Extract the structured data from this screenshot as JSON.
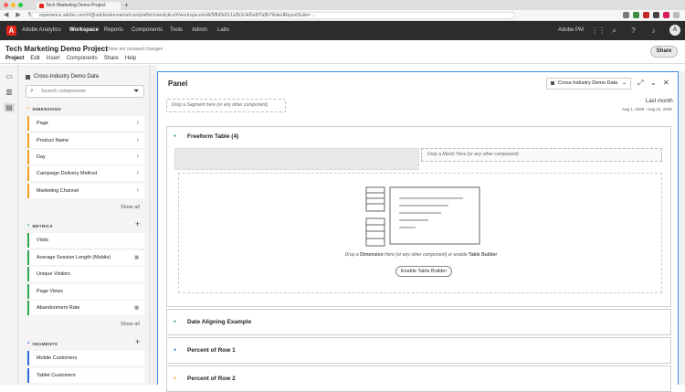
{
  "browser": {
    "tab_title": "Tech Marketing Demo Project",
    "new_tab": "+",
    "nav": "◀ ▶ ↻",
    "url": "experience.adobe.com/#/@adobedemoamericas/platform/analytics/#/workspace/edit/5f8d9e0c1a2b3c4d5e6f7a8b?linkedReportSuite=..."
  },
  "appbar": {
    "logo_letter": "A",
    "app_name": "Adobe Analytics",
    "nav": [
      "Workspace",
      "Reports",
      "Components",
      "Tools",
      "Admin",
      "Labs"
    ],
    "org": "Adobe PM",
    "avatar_letter": "A"
  },
  "project": {
    "title": "Tech Marketing Demo Project",
    "unsaved": "There are unsaved changes",
    "menu": [
      "Project",
      "Edit",
      "Insert",
      "Components",
      "Share",
      "Help"
    ],
    "share_label": "Share"
  },
  "sidebar": {
    "report_suite": "Cross-Industry Demo Data",
    "search_placeholder": "Search components",
    "dimensions_label": "DIMENSIONS",
    "dimensions": [
      "Page",
      "Product Name",
      "Day",
      "Campaign Delivery Method",
      "Marketing Channel"
    ],
    "metrics_label": "METRICS",
    "metrics": [
      "Visits",
      "Average Session Length (Mobile)",
      "Unique Visitors",
      "Page Views",
      "Abandonment Rate"
    ],
    "segments_label": "SEGMENTS",
    "segments": [
      "Mobile Customers",
      "Tablet Customers"
    ],
    "show_all": "Show all"
  },
  "panel": {
    "title": "Panel",
    "report_suite": "Cross-Industry Demo Data",
    "segment_drop": "Drop a Segment here (or any other component)",
    "date_label": "Last month",
    "date_range": "Aug 1, 2020 - Aug 31, 2020",
    "freeform": {
      "title": "Freeform Table (4)",
      "metric_drop": "Drop a Metric Here (or any other component)",
      "hint_prefix": "Drop a ",
      "hint_dimension": "Dimension",
      "hint_middle": " Here (or any other component) or enable ",
      "hint_builder": "Table Builder",
      "enable_button": "Enable Table Builder"
    },
    "visualizations": [
      "Date Aligning Example",
      "Percent of Row 1",
      "Percent of Row 2"
    ]
  },
  "colors": {
    "dimension_accent": "#f3a01d",
    "metric_accent": "#2ea44f",
    "segment_accent": "#2a6ad8",
    "panel_border": "#3b8eea",
    "viz_dot_green": "#2ea44f",
    "viz_dot_blue": "#2a6ad8",
    "viz_dot_orange": "#f3a01d"
  }
}
